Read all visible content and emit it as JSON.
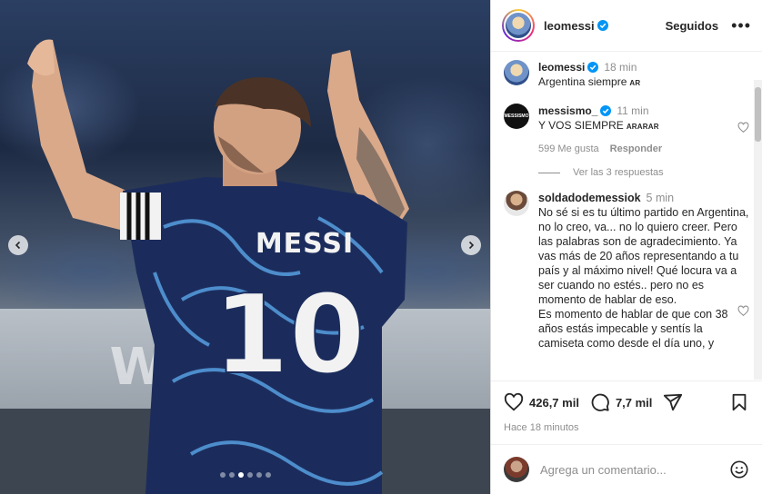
{
  "post": {
    "author": "leomessi",
    "following_label": "Seguidos",
    "more_label": "•••",
    "caption": {
      "user": "leomessi",
      "time": "18 min",
      "text": "Argentina siempre",
      "flag": "AR"
    },
    "board_text": "WARNER"
  },
  "comments": [
    {
      "user": "messismo_",
      "time": "11 min",
      "text": "Y VOS SIEMPRE",
      "flags": "ARARAR",
      "likes": "599 Me gusta",
      "reply_label": "Responder",
      "view_replies": "Ver las 3 respuestas",
      "avatar_text": "MESSISMO"
    },
    {
      "user": "soldadodemessiok",
      "time": "5 min",
      "text": "No sé si es tu último partido en Argentina, no lo creo, va... no lo quiero creer. Pero las palabras son de agradecimiento. Ya vas más de 20 años representando a tu país y al máximo nivel! Qué locura va a ser cuando no estés.. pero no es momento de hablar de eso.",
      "text2": "Es momento de hablar de que con 38 años estás impecable y sentís la camiseta como desde el día uno, y"
    }
  ],
  "actions": {
    "likes": "426,7 mil",
    "comments": "7,7 mil",
    "posted": "Hace 18 minutos"
  },
  "composer": {
    "placeholder": "Agrega un comentario..."
  },
  "carousel": {
    "total_dots": 6,
    "active_dot": 2
  },
  "colors": {
    "verified": "#0095f6",
    "jersey": "#1b2c5c",
    "jersey_swirl": "#5aa6e8"
  },
  "icons": [
    "verified-badge-icon",
    "more-icon",
    "heart-icon",
    "comment-icon",
    "share-icon",
    "bookmark-icon",
    "emoji-icon",
    "chevron-left-icon",
    "chevron-right-icon"
  ]
}
